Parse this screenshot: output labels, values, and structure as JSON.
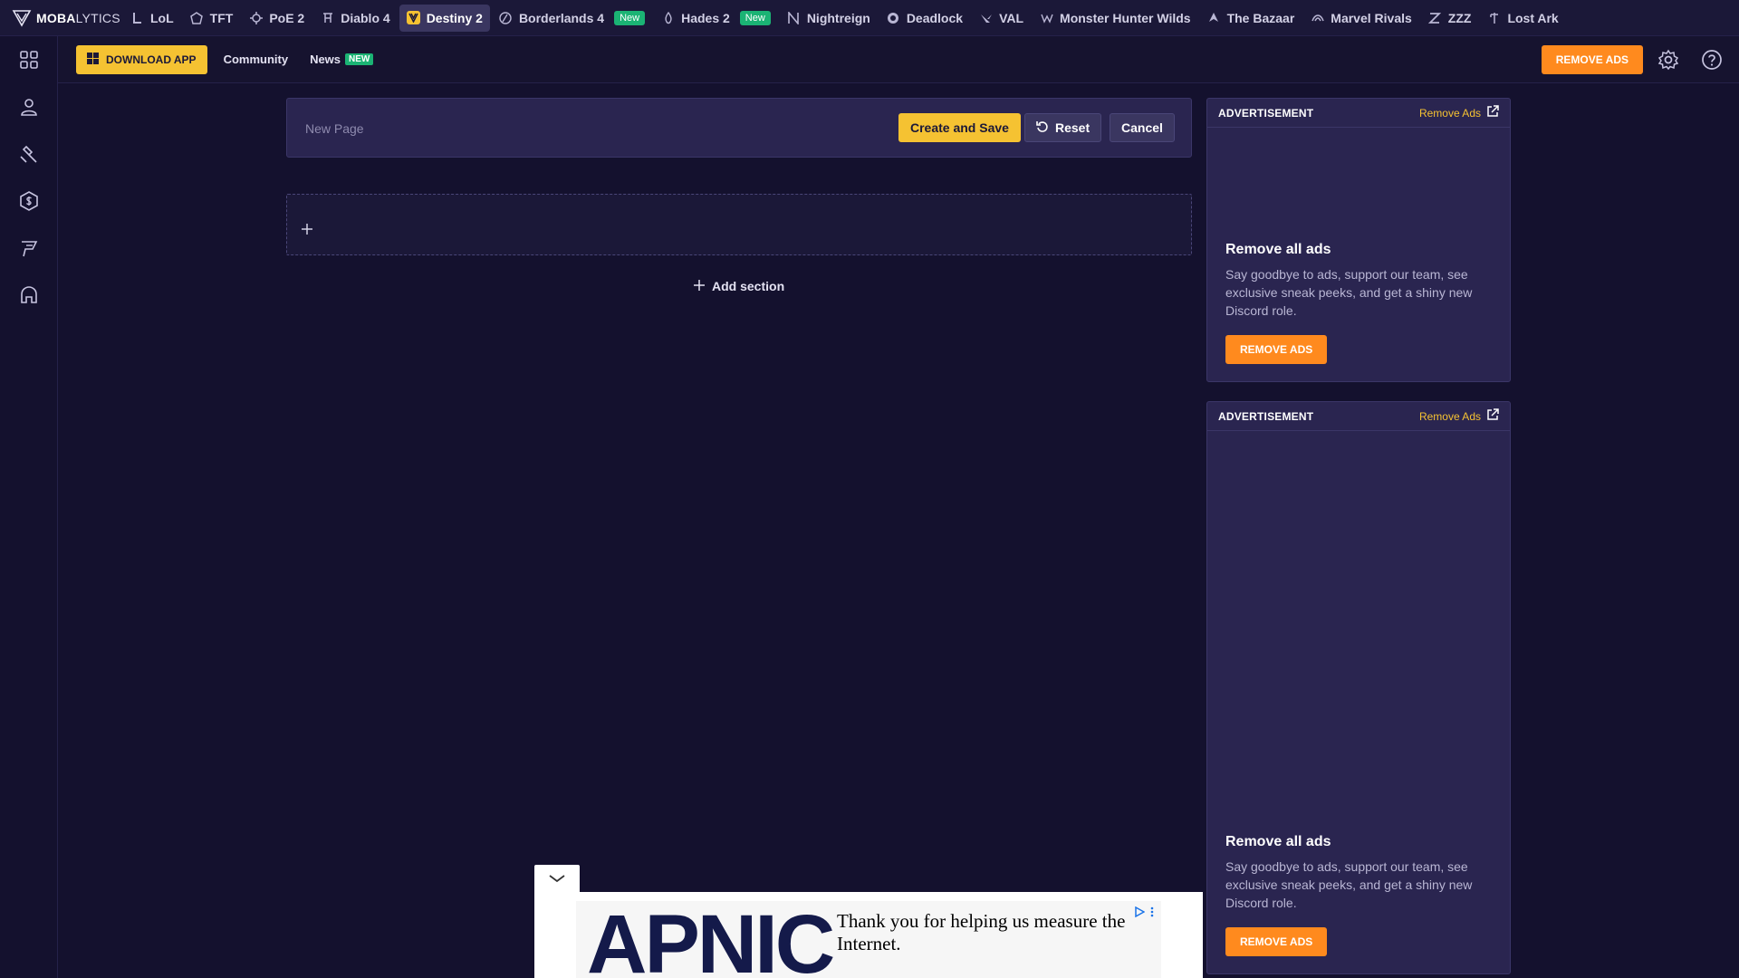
{
  "brand": {
    "name_bold": "MOBA",
    "name_light": "LYTICS"
  },
  "games": [
    {
      "label": "LoL",
      "icon": "lol-icon"
    },
    {
      "label": "TFT",
      "icon": "tft-icon"
    },
    {
      "label": "PoE 2",
      "icon": "poe2-icon"
    },
    {
      "label": "Diablo 4",
      "icon": "diablo4-icon"
    },
    {
      "label": "Destiny 2",
      "icon": "destiny2-icon",
      "active": true
    },
    {
      "label": "Borderlands 4",
      "icon": "borderlands4-icon",
      "badge": "New"
    },
    {
      "label": "Hades 2",
      "icon": "hades2-icon",
      "badge": "New"
    },
    {
      "label": "Nightreign",
      "icon": "nightreign-icon"
    },
    {
      "label": "Deadlock",
      "icon": "deadlock-icon"
    },
    {
      "label": "VAL",
      "icon": "valorant-icon"
    },
    {
      "label": "Monster Hunter Wilds",
      "icon": "monster-hunter-icon"
    },
    {
      "label": "The Bazaar",
      "icon": "bazaar-icon"
    },
    {
      "label": "Marvel Rivals",
      "icon": "marvel-rivals-icon"
    },
    {
      "label": "ZZZ",
      "icon": "zzz-icon"
    },
    {
      "label": "Lost Ark",
      "icon": "lost-ark-icon"
    }
  ],
  "subbar": {
    "download_label": "DOWNLOAD APP",
    "community_label": "Community",
    "news_label": "News",
    "news_badge": "NEW",
    "remove_ads_label": "REMOVE ADS"
  },
  "editor": {
    "title_placeholder": "New Page",
    "title_value": "",
    "create_label": "Create and Save",
    "reset_label": "Reset",
    "cancel_label": "Cancel",
    "add_section_label": "Add section"
  },
  "ads": [
    {
      "label": "ADVERTISEMENT",
      "remove_link": "Remove Ads",
      "title": "Remove all ads",
      "description": "Say goodbye to ads, support our team, see exclusive sneak peeks, and get a shiny new Discord role.",
      "button": "REMOVE ADS"
    },
    {
      "label": "ADVERTISEMENT",
      "remove_link": "Remove Ads",
      "title": "Remove all ads",
      "description": "Say goodbye to ads, support our team, see exclusive sneak peeks, and get a shiny new Discord role.",
      "button": "REMOVE ADS"
    }
  ],
  "banner": {
    "logo_text": "APNIC",
    "message": "Thank you for helping us measure the Internet."
  },
  "colors": {
    "background": "#14112e",
    "accent_yellow": "#f5c232",
    "accent_orange": "#ff8a1e",
    "badge_green": "#1bb374"
  }
}
